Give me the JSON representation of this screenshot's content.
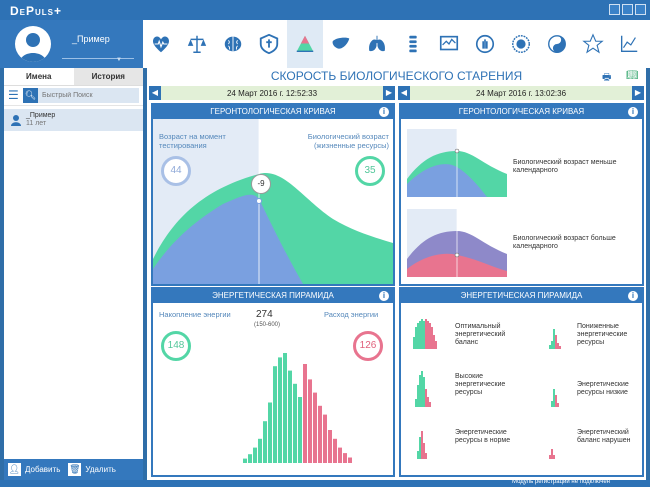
{
  "app": {
    "title": "DePuls+"
  },
  "profile": {
    "name": "_Пример"
  },
  "iconbar": {
    "icons": [
      "heart-pulse-icon",
      "scales-icon",
      "brain-icon",
      "shield-icon",
      "pyramid-icon",
      "liver-icon",
      "lungs-icon",
      "spine-icon",
      "chart-screen-icon",
      "hand-icon",
      "circle-eye-icon",
      "yin-yang-icon",
      "star-icon",
      "graph-icon"
    ]
  },
  "sidebar": {
    "tabs": [
      "Имена",
      "История"
    ],
    "search_placeholder": "Быстрый Поиск",
    "people": [
      {
        "name": "_Пример",
        "age": "11 лет"
      }
    ],
    "add_label": "Добавить",
    "delete_label": "Удалить"
  },
  "main": {
    "title": "СКОРОСТЬ БИОЛОГИЧЕСКОГО СТАРЕНИЯ",
    "left": {
      "date": "24 Март 2016 г. 12:52:33",
      "curve_title": "ГЕРОНТОЛОГИЧЕСКАЯ КРИВАЯ",
      "age_label": "Возраст на момент тестирования",
      "age_value": "44",
      "bio_label": "Биологический возраст (жизненные ресурсы)",
      "bio_value": "35",
      "diff_value": "-9",
      "pyr_title": "ЭНЕРГЕТИЧЕСКАЯ ПИРАМИДА",
      "acc_label": "Накопление энергии",
      "total": "274",
      "range": "(150-600)",
      "spend_label": "Расход энергии",
      "acc_value": "148",
      "spend_value": "126"
    },
    "right": {
      "date": "24 Март 2016 г. 13:02:36",
      "curve_title": "ГЕРОНТОЛОГИЧЕСКАЯ КРИВАЯ",
      "curve_less": "Биологический возраст меньше календарного",
      "curve_more": "Биологический возраст больше календарного",
      "pyr_title": "ЭНЕРГЕТИЧЕСКАЯ ПИРАМИДА",
      "legend": [
        "Оптимальный энергетический баланс",
        "Пониженные энергетические ресурсы",
        "Высокие энергетические ресурсы",
        "Энергетические ресурсы низкие",
        "Энергетические ресурсы в норме",
        "Энергетический баланс нарушен"
      ]
    }
  },
  "status": {
    "text": "Модуль регистрации не подключен"
  },
  "colors": {
    "accent": "#3478bd",
    "green": "#53d6a6",
    "blue": "#7aa0e0",
    "pink": "#e8748f"
  }
}
